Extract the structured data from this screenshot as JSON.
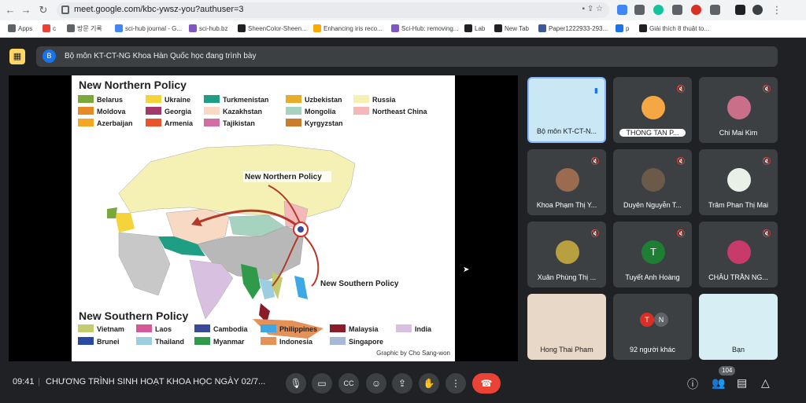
{
  "browser": {
    "url": "meet.google.com/kbc-ywsz-you?authuser=3"
  },
  "bookmarks": [
    {
      "label": "Apps",
      "color": "#5f6368"
    },
    {
      "label": "c",
      "color": "#ea4335"
    },
    {
      "label": "방문 기록",
      "color": "#5f6368"
    },
    {
      "label": "sci-hub journal - G...",
      "color": "#4285f4"
    },
    {
      "label": "sci-hub.bz",
      "color": "#7e57c2"
    },
    {
      "label": "SheenColor-Sheen...",
      "color": "#202124"
    },
    {
      "label": "Enhancing iris reco...",
      "color": "#f9ab00"
    },
    {
      "label": "Sci-Hub: removing...",
      "color": "#7e57c2"
    },
    {
      "label": "Lab",
      "color": "#202124"
    },
    {
      "label": "New Tab",
      "color": "#202124"
    },
    {
      "label": "Paper1222933-293...",
      "color": "#3b5998"
    },
    {
      "label": "p",
      "color": "#1a73e8"
    },
    {
      "label": "Giải thích 8 thuật to...",
      "color": "#202124"
    }
  ],
  "banner": {
    "avatar": "B",
    "text": "Bộ môn KT-CT-NG Khoa Hàn Quốc học đang trình bày"
  },
  "slide": {
    "north_title": "New Northern Policy",
    "south_title": "New Southern Policy",
    "north_legend": [
      {
        "label": "Belarus",
        "color": "#7aa83b"
      },
      {
        "label": "Ukraine",
        "color": "#f5d33a"
      },
      {
        "label": "Turkmenistan",
        "color": "#1e9e84"
      },
      {
        "label": "Uzbekistan",
        "color": "#e6ac2a"
      },
      {
        "label": "Russia",
        "color": "#f5f0b3"
      },
      {
        "label": "Moldova",
        "color": "#e58a24"
      },
      {
        "label": "Georgia",
        "color": "#a3396b"
      },
      {
        "label": "Kazakhstan",
        "color": "#f7d9c4"
      },
      {
        "label": "Mongolia",
        "color": "#a6d3c0"
      },
      {
        "label": "Northeast China",
        "color": "#f4b8b8"
      },
      {
        "label": "Azerbaijan",
        "color": "#f5a623"
      },
      {
        "label": "Armenia",
        "color": "#e8552b"
      },
      {
        "label": "Tajikistan",
        "color": "#cf6fa3"
      },
      {
        "label": "Kyrgyzstan",
        "color": "#c97d2a"
      }
    ],
    "south_legend": [
      {
        "label": "Vietnam",
        "color": "#c4cc6f"
      },
      {
        "label": "Laos",
        "color": "#d8569a"
      },
      {
        "label": "Cambodia",
        "color": "#3a4a9a"
      },
      {
        "label": "Philippines",
        "color": "#3ea8e5"
      },
      {
        "label": "Malaysia",
        "color": "#8a1c2a"
      },
      {
        "label": "India",
        "color": "#d8c0e0"
      },
      {
        "label": "Brunei",
        "color": "#2a4aa0"
      },
      {
        "label": "Thailand",
        "color": "#9ccde0"
      },
      {
        "label": "Myanmar",
        "color": "#2e9a4a"
      },
      {
        "label": "Indonesia",
        "color": "#e5915a"
      },
      {
        "label": "Singapore",
        "color": "#a8b8d8"
      }
    ],
    "map_label_north": "New Northern Policy",
    "map_label_south": "New Southern Policy",
    "credit": "Graphic by Cho Sang-won"
  },
  "participants": [
    {
      "name": "Bộ môn KT-CT-N...",
      "muted": false
    },
    {
      "name": "THONG TAN P...",
      "muted": true
    },
    {
      "name": "Chi Mai Kim",
      "muted": true
    },
    {
      "name": "Khoa Phạm Thị Y...",
      "muted": true
    },
    {
      "name": "Duyên Nguyễn T...",
      "muted": true
    },
    {
      "name": "Trâm Phan Thị Mai",
      "muted": true
    },
    {
      "name": "Xuân Phùng Thị ...",
      "muted": true
    },
    {
      "name": "Tuyết Anh Hoàng",
      "muted": true,
      "initial": "T"
    },
    {
      "name": "CHÂU TRẦN NG...",
      "muted": true
    },
    {
      "name": "Hong Thai Pham",
      "muted": false
    },
    {
      "name": "92 người khác",
      "muted": false,
      "initials": [
        "T",
        "N"
      ]
    },
    {
      "name": "Bạn",
      "muted": false
    }
  ],
  "bottom": {
    "time": "09:41",
    "meeting_title": "CHƯƠNG TRÌNH SINH HOẠT KHOA HỌC NGÀY 02/7...",
    "participant_count": "104"
  },
  "icons": {
    "mic": "mic-icon",
    "camera": "camera-icon",
    "captions": "cc-icon",
    "emoji": "emoji-icon",
    "present": "present-icon",
    "hand": "hand-icon",
    "more": "more-icon",
    "end": "end-call-icon"
  }
}
